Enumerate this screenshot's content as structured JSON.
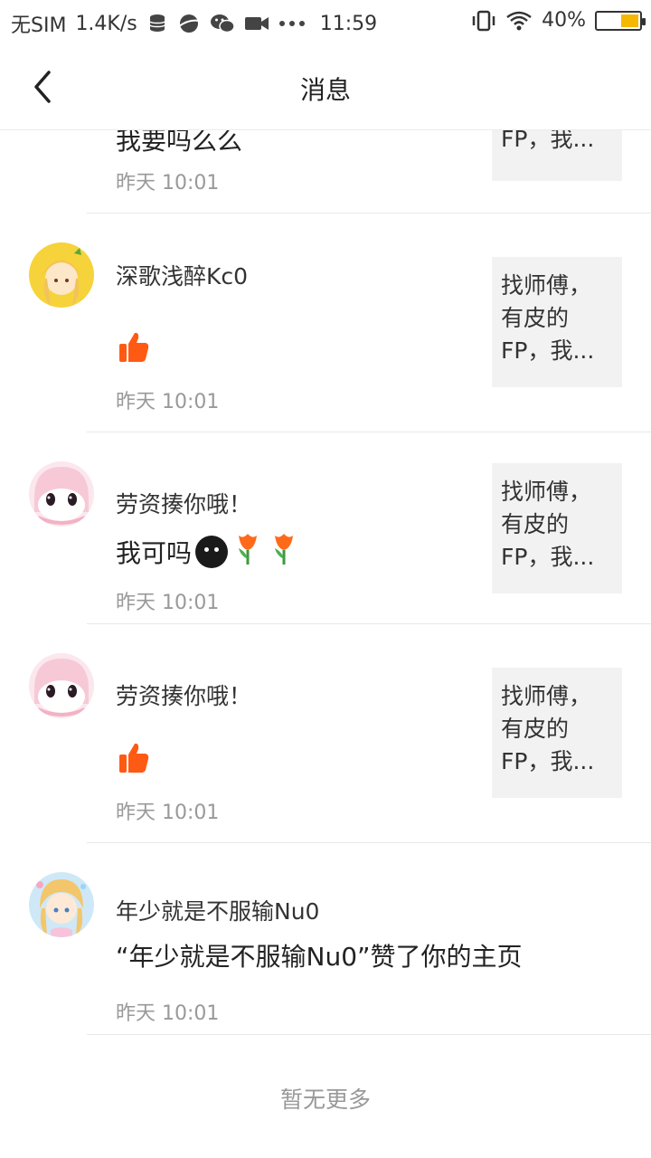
{
  "status_bar": {
    "carrier": "无SIM",
    "speed": "1.4K/s",
    "time": "11:59",
    "battery": "40%",
    "battery_level": 0.4,
    "icons": [
      "database-icon",
      "planet-icon",
      "wechat-icon",
      "video-icon",
      "more-icon",
      "vibrate-icon",
      "wifi-icon",
      "battery-icon"
    ]
  },
  "header": {
    "title": "消息",
    "back_icon": "chevron-left-icon"
  },
  "messages": [
    {
      "name": "",
      "content": "我要吗么么",
      "time": "昨天 10:01",
      "thumb_text": "FP，我..."
    },
    {
      "name": "深歌浅醉Kc0",
      "content_type": "like",
      "time": "昨天 10:01",
      "thumb_text": "找师傅，有皮的FP，我..."
    },
    {
      "name": "劳资揍你哦！",
      "content": "我可吗",
      "content_emojis": [
        "face-emoji",
        "tulip-emoji",
        "tulip-emoji"
      ],
      "time": "昨天 10:01",
      "thumb_text": "找师傅，有皮的FP，我..."
    },
    {
      "name": "劳资揍你哦！",
      "content_type": "like",
      "time": "昨天 10:01",
      "thumb_text": "找师傅，有皮的FP，我..."
    },
    {
      "name": "年少就是不服输Nu0",
      "content": "“年少就是不服输Nu0”赞了你的主页",
      "time": "昨天 10:01"
    }
  ],
  "footer": {
    "text": "暂无更多"
  },
  "colors": {
    "like": "#ff5a14",
    "time": "#999999",
    "thumb_bg": "#f2f2f2",
    "battery": "#f5b800"
  }
}
